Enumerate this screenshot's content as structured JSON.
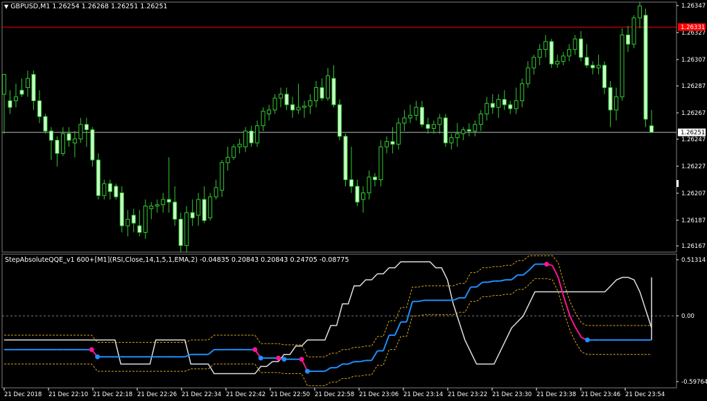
{
  "price_panel": {
    "header": "GBPUSD,M1  1.26254 1.26268 1.26251 1.26251",
    "menu_icon": "triangle-down-icon",
    "y_ticks": [
      "1.26347",
      "1.26327",
      "1.26307",
      "1.26287",
      "1.26267",
      "1.26247",
      "1.26227",
      "1.26207",
      "1.26187",
      "1.26167"
    ],
    "ask_label": "1.26331",
    "bid_label": "1.26251",
    "colors": {
      "bull": "#32CD32",
      "bear": "#ccffcc",
      "ask_line": "#ff0000",
      "bid_line": "#c0c0c0",
      "ask_tag": "#ff0000",
      "bid_tag": "#ffffff"
    }
  },
  "indicator_panel": {
    "header": "StepAbsoluteQQE_v1 600+[M1](RSI,Close,14,1,5,1,EMA,2) -0.04835 0.20843 0.20843 0.24705 -0.08775",
    "y_ticks": [
      "0.51314",
      "0.00",
      "-0.59764"
    ],
    "colors": {
      "qqe_up": "#1e90ff",
      "qqe_down": "#ff1493",
      "band": "#e0e0e0",
      "level": "#daa520",
      "zero": "#808080"
    }
  },
  "x_ticks": [
    "21 Dec 2018",
    "21 Dec 22:10",
    "21 Dec 22:18",
    "21 Dec 22:26",
    "21 Dec 22:34",
    "21 Dec 22:42",
    "21 Dec 22:50",
    "21 Dec 22:58",
    "21 Dec 23:06",
    "21 Dec 23:14",
    "21 Dec 23:22",
    "21 Dec 23:30",
    "21 Dec 23:38",
    "21 Dec 23:46",
    "21 Dec 23:54"
  ],
  "chart_data": {
    "type": "candlestick",
    "symbol": "GBPUSD",
    "timeframe": "M1",
    "price_ylim": [
      1.2616,
      1.2635
    ],
    "indicator_ylim": [
      -0.59764,
      0.51314
    ],
    "candles": [
      [
        1.2628,
        1.26295,
        1.2625,
        1.26295
      ],
      [
        1.26275,
        1.26283,
        1.26265,
        1.2627
      ],
      [
        1.26275,
        1.26288,
        1.2627,
        1.26278
      ],
      [
        1.26283,
        1.26292,
        1.26278,
        1.2628
      ],
      [
        1.26285,
        1.26298,
        1.26278,
        1.26292
      ],
      [
        1.26295,
        1.26298,
        1.26268,
        1.26275
      ],
      [
        1.26275,
        1.26283,
        1.26258,
        1.26263
      ],
      [
        1.26263,
        1.26265,
        1.2625,
        1.26252
      ],
      [
        1.26252,
        1.26255,
        1.2623,
        1.26245
      ],
      [
        1.26245,
        1.26248,
        1.26225,
        1.26235
      ],
      [
        1.26235,
        1.26255,
        1.26233,
        1.2625
      ],
      [
        1.2625,
        1.26255,
        1.2624,
        1.26245
      ],
      [
        1.26243,
        1.26252,
        1.26232,
        1.26246
      ],
      [
        1.26246,
        1.26262,
        1.26243,
        1.26257
      ],
      [
        1.26257,
        1.26262,
        1.2624,
        1.26253
      ],
      [
        1.26253,
        1.26255,
        1.26225,
        1.2623
      ],
      [
        1.2623,
        1.26235,
        1.262,
        1.26203
      ],
      [
        1.26203,
        1.26215,
        1.262,
        1.26212
      ],
      [
        1.26212,
        1.26215,
        1.262,
        1.26206
      ],
      [
        1.2621,
        1.26212,
        1.262,
        1.26202
      ],
      [
        1.26205,
        1.2621,
        1.26175,
        1.2618
      ],
      [
        1.2618,
        1.26192,
        1.26172,
        1.26185
      ],
      [
        1.26188,
        1.26193,
        1.26175,
        1.26182
      ],
      [
        1.2618,
        1.26192,
        1.26172,
        1.26175
      ],
      [
        1.26175,
        1.262,
        1.2617,
        1.26195
      ],
      [
        1.26193,
        1.26198,
        1.26185,
        1.26195
      ],
      [
        1.26195,
        1.262,
        1.2619,
        1.26196
      ],
      [
        1.26196,
        1.26205,
        1.2619,
        1.262
      ],
      [
        1.262,
        1.26232,
        1.2619,
        1.26198
      ],
      [
        1.26198,
        1.2621,
        1.2618,
        1.26185
      ],
      [
        1.26185,
        1.2619,
        1.2616,
        1.26165
      ],
      [
        1.26165,
        1.26195,
        1.2616,
        1.2619
      ],
      [
        1.2619,
        1.262,
        1.2618,
        1.26186
      ],
      [
        1.26188,
        1.26205,
        1.2618,
        1.262
      ],
      [
        1.262,
        1.2621,
        1.26182,
        1.26184
      ],
      [
        1.26186,
        1.26205,
        1.26184,
        1.26202
      ],
      [
        1.26202,
        1.26215,
        1.262,
        1.26209
      ],
      [
        1.26207,
        1.2623,
        1.26202,
        1.26228
      ],
      [
        1.26228,
        1.2624,
        1.26222,
        1.26232
      ],
      [
        1.26232,
        1.26242,
        1.2623,
        1.2624
      ],
      [
        1.2624,
        1.26246,
        1.26235,
        1.26242
      ],
      [
        1.2624,
        1.26255,
        1.26236,
        1.26252
      ],
      [
        1.26252,
        1.26256,
        1.2624,
        1.26243
      ],
      [
        1.26243,
        1.2626,
        1.2624,
        1.26256
      ],
      [
        1.26256,
        1.2627,
        1.26252,
        1.26267
      ],
      [
        1.26265,
        1.26272,
        1.2626,
        1.26268
      ],
      [
        1.26268,
        1.2628,
        1.26265,
        1.26277
      ],
      [
        1.26277,
        1.26285,
        1.2627,
        1.2628
      ],
      [
        1.2628,
        1.26285,
        1.26268,
        1.26272
      ],
      [
        1.26272,
        1.26278,
        1.26262,
        1.26268
      ],
      [
        1.26268,
        1.26288,
        1.26265,
        1.2627
      ],
      [
        1.2627,
        1.26275,
        1.26262,
        1.26271
      ],
      [
        1.26271,
        1.2628,
        1.26265,
        1.26275
      ],
      [
        1.26275,
        1.2629,
        1.2627,
        1.26285
      ],
      [
        1.26285,
        1.26292,
        1.26275,
        1.26277
      ],
      [
        1.26277,
        1.263,
        1.26275,
        1.26294
      ],
      [
        1.26292,
        1.26302,
        1.2627,
        1.26272
      ],
      [
        1.26272,
        1.26276,
        1.26245,
        1.26248
      ],
      [
        1.26248,
        1.2625,
        1.2621,
        1.26215
      ],
      [
        1.26215,
        1.2624,
        1.26205,
        1.2621
      ],
      [
        1.2621,
        1.26215,
        1.26195,
        1.26198
      ],
      [
        1.262,
        1.2621,
        1.2619,
        1.26205
      ],
      [
        1.26205,
        1.26222,
        1.262,
        1.26217
      ],
      [
        1.26217,
        1.2622,
        1.2621,
        1.26215
      ],
      [
        1.26215,
        1.26245,
        1.2621,
        1.2624
      ],
      [
        1.2624,
        1.26248,
        1.26235,
        1.26244
      ],
      [
        1.26244,
        1.26255,
        1.26235,
        1.26242
      ],
      [
        1.26242,
        1.26262,
        1.26238,
        1.26258
      ],
      [
        1.26258,
        1.26268,
        1.26252,
        1.26262
      ],
      [
        1.26262,
        1.26272,
        1.26258,
        1.26264
      ],
      [
        1.26264,
        1.26275,
        1.2626,
        1.2627
      ],
      [
        1.2627,
        1.26275,
        1.26255,
        1.26257
      ],
      [
        1.26257,
        1.26262,
        1.2625,
        1.26254
      ],
      [
        1.26254,
        1.2626,
        1.2625,
        1.26257
      ],
      [
        1.26257,
        1.26265,
        1.2625,
        1.26262
      ],
      [
        1.26262,
        1.26265,
        1.2624,
        1.26243
      ],
      [
        1.26243,
        1.2625,
        1.26238,
        1.26247
      ],
      [
        1.26247,
        1.26258,
        1.2624,
        1.2625
      ],
      [
        1.2625,
        1.26255,
        1.26245,
        1.26253
      ],
      [
        1.26253,
        1.26258,
        1.26248,
        1.26252
      ],
      [
        1.26252,
        1.2626,
        1.26248,
        1.26257
      ],
      [
        1.26257,
        1.26268,
        1.26252,
        1.26265
      ],
      [
        1.26265,
        1.26278,
        1.2626,
        1.26273
      ],
      [
        1.26273,
        1.2628,
        1.26265,
        1.2627
      ],
      [
        1.2627,
        1.2628,
        1.26262,
        1.26276
      ],
      [
        1.26276,
        1.26283,
        1.26268,
        1.26272
      ],
      [
        1.26272,
        1.26275,
        1.26265,
        1.26269
      ],
      [
        1.26269,
        1.26285,
        1.26265,
        1.26275
      ],
      [
        1.26275,
        1.26292,
        1.2627,
        1.26288
      ],
      [
        1.26288,
        1.26305,
        1.26285,
        1.263
      ],
      [
        1.263,
        1.2631,
        1.26295,
        1.26308
      ],
      [
        1.26308,
        1.26318,
        1.26302,
        1.26314
      ],
      [
        1.26314,
        1.26325,
        1.26308,
        1.2632
      ],
      [
        1.2632,
        1.26322,
        1.263,
        1.26303
      ],
      [
        1.26303,
        1.2631,
        1.263,
        1.26305
      ],
      [
        1.26305,
        1.26312,
        1.26302,
        1.26309
      ],
      [
        1.26309,
        1.26318,
        1.26305,
        1.26314
      ],
      [
        1.26314,
        1.26325,
        1.2631,
        1.26322
      ],
      [
        1.26322,
        1.26328,
        1.26305,
        1.26308
      ],
      [
        1.26308,
        1.26318,
        1.263,
        1.26302
      ],
      [
        1.26302,
        1.26305,
        1.26295,
        1.263
      ],
      [
        1.263,
        1.2631,
        1.26295,
        1.26302
      ],
      [
        1.26302,
        1.26305,
        1.2628,
        1.26285
      ],
      [
        1.26285,
        1.2629,
        1.26255,
        1.26268
      ],
      [
        1.26268,
        1.26285,
        1.2626,
        1.26278
      ],
      [
        1.26278,
        1.2633,
        1.26275,
        1.26325
      ],
      [
        1.26325,
        1.26332,
        1.26312,
        1.26318
      ],
      [
        1.26318,
        1.2634,
        1.26315,
        1.26338
      ],
      [
        1.26338,
        1.2635,
        1.2633,
        1.26347
      ],
      [
        1.2634,
        1.26345,
        1.26255,
        1.26261
      ],
      [
        1.26256,
        1.26268,
        1.26251,
        1.26251
      ]
    ],
    "qqe_line": [
      -0.28,
      -0.28,
      -0.28,
      -0.28,
      -0.28,
      -0.28,
      -0.28,
      -0.28,
      -0.28,
      -0.28,
      -0.28,
      -0.28,
      -0.28,
      -0.28,
      -0.28,
      -0.28,
      -0.34,
      -0.34,
      -0.34,
      -0.34,
      -0.34,
      -0.34,
      -0.34,
      -0.34,
      -0.34,
      -0.34,
      -0.34,
      -0.34,
      -0.34,
      -0.34,
      -0.34,
      -0.34,
      -0.32,
      -0.32,
      -0.32,
      -0.32,
      -0.28,
      -0.28,
      -0.28,
      -0.28,
      -0.28,
      -0.28,
      -0.28,
      -0.28,
      -0.35,
      -0.35,
      -0.35,
      -0.35,
      -0.36,
      -0.36,
      -0.36,
      -0.36,
      -0.46,
      -0.46,
      -0.46,
      -0.46,
      -0.43,
      -0.43,
      -0.4,
      -0.4,
      -0.38,
      -0.38,
      -0.37,
      -0.37,
      -0.29,
      -0.29,
      -0.16,
      -0.16,
      -0.05,
      -0.05,
      0.12,
      0.12,
      0.13,
      0.13,
      0.13,
      0.13,
      0.13,
      0.13,
      0.15,
      0.15,
      0.24,
      0.24,
      0.28,
      0.28,
      0.29,
      0.29,
      0.3,
      0.3,
      0.34,
      0.34,
      0.38,
      0.43,
      0.43,
      0.43,
      0.42,
      0.32,
      0.15,
      0.0,
      -0.1,
      -0.18,
      -0.2,
      -0.2,
      -0.2,
      -0.2,
      -0.2,
      -0.2,
      -0.2,
      -0.2,
      -0.2,
      -0.2,
      -0.2,
      -0.2
    ],
    "band_line": [
      -0.2,
      -0.2,
      -0.2,
      -0.2,
      -0.2,
      -0.2,
      -0.2,
      -0.2,
      -0.2,
      -0.2,
      -0.2,
      -0.2,
      -0.2,
      -0.2,
      -0.2,
      -0.2,
      -0.2,
      -0.2,
      -0.2,
      -0.2,
      -0.4,
      -0.4,
      -0.4,
      -0.4,
      -0.4,
      -0.4,
      -0.2,
      -0.2,
      -0.2,
      -0.2,
      -0.2,
      -0.2,
      -0.4,
      -0.4,
      -0.4,
      -0.4,
      -0.48,
      -0.48,
      -0.48,
      -0.48,
      -0.48,
      -0.48,
      -0.48,
      -0.48,
      -0.42,
      -0.42,
      -0.38,
      -0.38,
      -0.32,
      -0.32,
      -0.25,
      -0.25,
      -0.2,
      -0.2,
      -0.2,
      -0.2,
      -0.08,
      -0.08,
      0.1,
      0.1,
      0.25,
      0.25,
      0.3,
      0.3,
      0.35,
      0.35,
      0.4,
      0.4,
      0.45,
      0.45,
      0.45,
      0.45,
      0.45,
      0.45,
      0.4,
      0.4,
      0.3,
      0.1,
      -0.05,
      -0.2,
      -0.3,
      -0.4,
      -0.4,
      -0.4,
      -0.4,
      -0.3,
      -0.2,
      -0.1,
      -0.05,
      0.0,
      0.1,
      0.2,
      0.2,
      0.2,
      0.2,
      0.2,
      0.2,
      0.2,
      0.2,
      0.2,
      0.2,
      0.2,
      0.2,
      0.2,
      0.25,
      0.3,
      0.32,
      0.32,
      0.3,
      0.2,
      0.05,
      -0.1,
      -0.2,
      -0.1,
      0.1,
      0.32
    ],
    "zero_level": 0.0
  }
}
